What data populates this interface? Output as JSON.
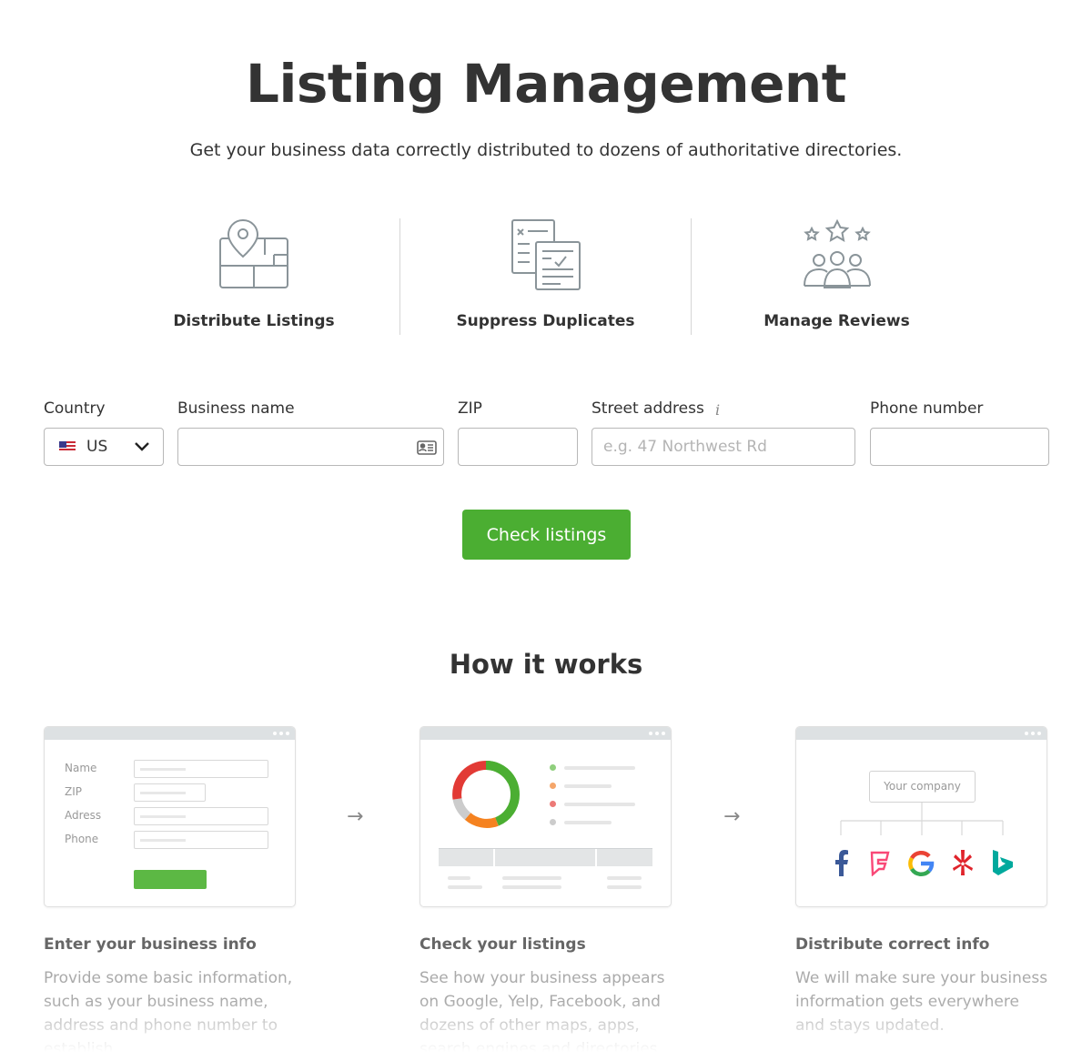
{
  "header": {
    "title": "Listing Management",
    "subtitle": "Get your business data correctly distributed to dozens of authoritative directories."
  },
  "features": [
    {
      "label": "Distribute Listings",
      "icon": "map-pin-icon"
    },
    {
      "label": "Suppress Duplicates",
      "icon": "documents-icon"
    },
    {
      "label": "Manage Reviews",
      "icon": "people-stars-icon"
    }
  ],
  "form": {
    "country_label": "Country",
    "country_value": "US",
    "business_label": "Business name",
    "business_value": "",
    "zip_label": "ZIP",
    "zip_value": "",
    "street_label": "Street address",
    "street_placeholder": "e.g. 47 Northwest Rd",
    "info_glyph": "i",
    "phone_label": "Phone number",
    "phone_value": "",
    "submit_label": "Check listings"
  },
  "how": {
    "title": "How it works",
    "arrow": "→",
    "mock_form_labels": [
      "Name",
      "ZIP",
      "Adress",
      "Phone"
    ],
    "mock_company": "Your company",
    "steps": [
      {
        "title": "Enter your business info",
        "text": "Provide some basic information, such as your business name, address and phone number to establish."
      },
      {
        "title": "Check your listings",
        "text": "See how your business appears on Google, Yelp, Facebook, and dozens of other maps, apps, search engines and directories."
      },
      {
        "title": "Distribute correct info",
        "text": "We will make sure your business information gets everywhere and stays updated."
      }
    ]
  },
  "colors": {
    "accent_green": "#4bae32",
    "donut_green": "#4bae32",
    "donut_red": "#e23a35",
    "donut_orange": "#f58220",
    "donut_gray": "#cccccc"
  }
}
